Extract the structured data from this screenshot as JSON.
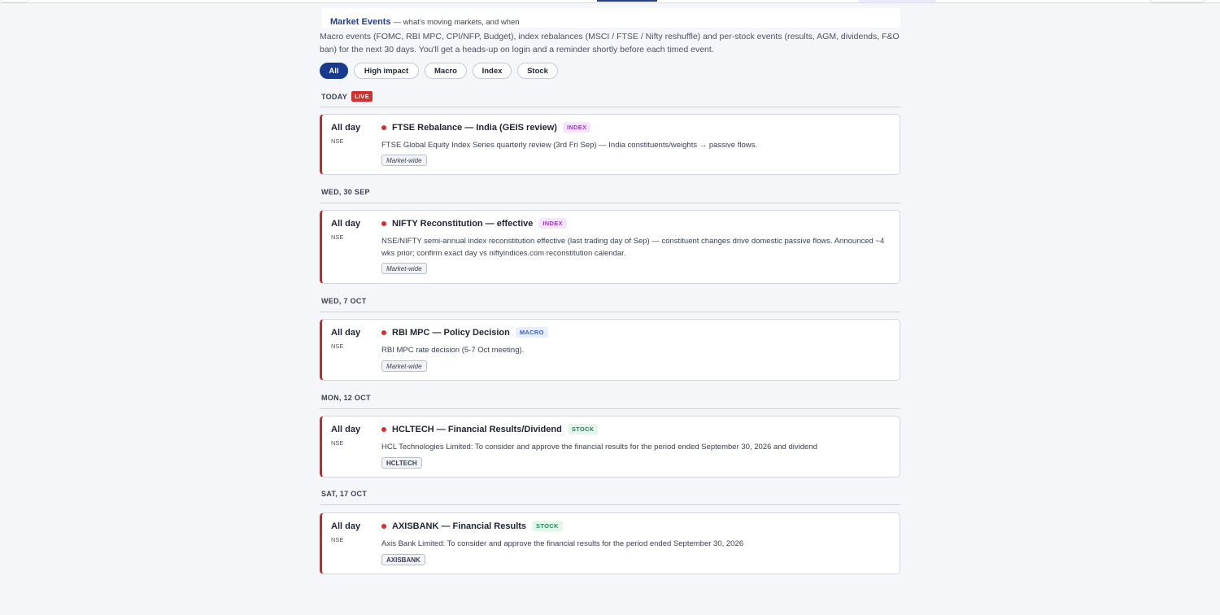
{
  "header": {
    "title": "Market Events",
    "subtitle": "— what's moving markets, and when",
    "description": "Macro events (FOMC, RBI MPC, CPI/NFP, Budget), index rebalances (MSCI / FTSE / Nifty reshuffle) and per-stock events (results, AGM, dividends, F&O ban) for the next 30 days. You'll get a heads-up on login and a reminder shortly before each timed event."
  },
  "filters": [
    "All",
    "High impact",
    "Macro",
    "Index",
    "Stock"
  ],
  "days": [
    {
      "label": "TODAY",
      "live": "LIVE",
      "event": {
        "time": "All day",
        "exchange": "NSE",
        "title": "FTSE Rebalance — India (GEIS review)",
        "badge": "INDEX",
        "description": "FTSE Global Equity Index Series quarterly review (3rd Fri Sep) — India constituents/weights → passive flows.",
        "tag": "Market-wide"
      }
    },
    {
      "label": "WED, 30 SEP",
      "event": {
        "time": "All day",
        "exchange": "NSE",
        "title": "NIFTY Reconstitution — effective",
        "badge": "INDEX",
        "description": "NSE/NIFTY semi-annual index reconstitution effective (last trading day of Sep) — constituent changes drive domestic passive flows. Announced ~4 wks prior; confirm exact day vs niftyindices.com reconstitution calendar.",
        "tag": "Market-wide"
      }
    },
    {
      "label": "WED, 7 OCT",
      "event": {
        "time": "All day",
        "exchange": "NSE",
        "title": "RBI MPC — Policy Decision",
        "badge": "MACRO",
        "description": "RBI MPC rate decision (5-7 Oct meeting).",
        "tag": "Market-wide"
      }
    },
    {
      "label": "MON, 12 OCT",
      "event": {
        "time": "All day",
        "exchange": "NSE",
        "title": "HCLTECH — Financial Results/Dividend",
        "badge": "STOCK",
        "description": "HCL Technologies Limited: To consider and approve the financial results for the period ended September 30, 2026 and dividend",
        "tag": "HCLTECH"
      }
    },
    {
      "label": "SAT, 17 OCT",
      "event": {
        "time": "All day",
        "exchange": "NSE",
        "title": "AXISBANK — Financial Results",
        "badge": "STOCK",
        "description": "Axis Bank Limited: To consider and approve the financial results for the period ended September 30, 2026",
        "tag": "AXISBANK"
      }
    }
  ],
  "colors": {
    "accent": "#183a8c",
    "live": "#d32f2f",
    "card_border": "#c62828",
    "index_badge": "#9a3bc2",
    "macro_badge": "#3a5fc7",
    "stock_badge": "#258a55"
  }
}
